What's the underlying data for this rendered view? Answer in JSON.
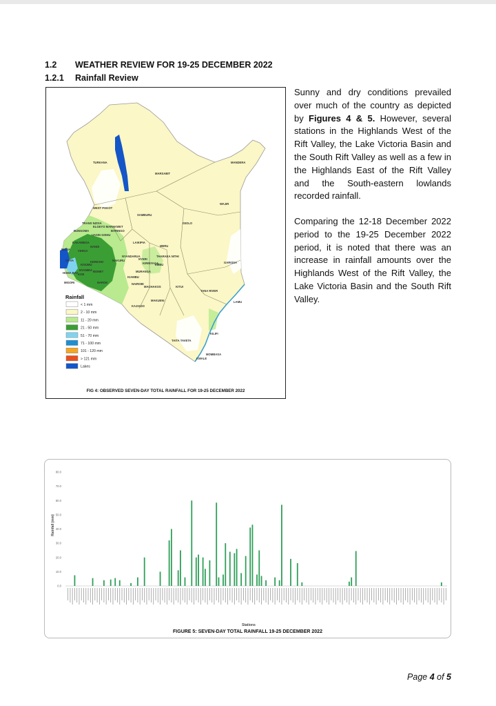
{
  "section": {
    "number": "1.2",
    "title": "WEATHER REVIEW FOR 19-25 DECEMBER 2022",
    "sub_number": "1.2.1",
    "sub_title": "Rainfall Review"
  },
  "map": {
    "caption": "FIG 4: OBSERVED SEVEN-DAY TOTAL RAINFALL FOR 19-25 DECEMBER 2022",
    "legend_title": "Rainfall",
    "legend": [
      {
        "label": "< 1 mm",
        "color": "#ffffff"
      },
      {
        "label": "2 - 10 mm",
        "color": "#fbf7c6"
      },
      {
        "label": "11 - 20 mm",
        "color": "#b9ea8f"
      },
      {
        "label": "21 - 50 mm",
        "color": "#3a9e34"
      },
      {
        "label": "51 - 70 mm",
        "color": "#7fd3ee"
      },
      {
        "label": "71 - 100 mm",
        "color": "#1e8fd2"
      },
      {
        "label": "101 - 120 mm",
        "color": "#f5a623"
      },
      {
        "label": "> 121 mm",
        "color": "#e8501e"
      },
      {
        "label": "Lakes",
        "color": "#1455c8"
      }
    ],
    "county_labels": [
      "TURKANA",
      "MANDERA",
      "MARSABIT",
      "WAJIR",
      "WEST POKOT",
      "SAMBURU",
      "ISIOLO",
      "TRANS NZOIA",
      "ELGEYO MARAKWET",
      "BARINGO",
      "UASIN GISHU",
      "BUNGOMA",
      "KAKAMEGA",
      "NANDI",
      "LAIKIPIA",
      "MERU",
      "BUSIA",
      "VIHIGA",
      "KISUMU",
      "SIAYA",
      "KERICHO",
      "NAKURU",
      "NYANDARUA",
      "NYERI",
      "THARAKA NITHI",
      "EMBU",
      "KIRINYAGA",
      "MURANGA",
      "BOMET",
      "NYAMIRA",
      "KISII",
      "HOMA BAY",
      "MIGORI",
      "NAROK",
      "KIAMBU",
      "NAIROBI",
      "MACHAKOS",
      "KITUI",
      "GARISSA",
      "TANA RIVER",
      "KAJIADO",
      "MAKUENI",
      "LAMU",
      "KILIFI",
      "TAITA TAVETA",
      "KWALE",
      "MOMBASA"
    ]
  },
  "text": {
    "p1_before": "Sunny and dry conditions prevailed over much of the country as depicted by ",
    "p1_bold": "Figures 4 & 5.",
    "p1_after": " However, several stations in the Highlands West of the Rift Valley, the Lake Victoria Basin and the South Rift Valley as well as a few in the Highlands East of the Rift Valley and the South-eastern lowlands recorded rainfall.",
    "p2": "Comparing the 12-18 December 2022 period to the 19-25 December 2022 period, it is noted that there was an increase in rainfall amounts over the Highlands West of the Rift Valley, the Lake Victoria Basin and the South Rift Valley."
  },
  "chart": {
    "caption": "FIGURE 5: SEVEN-DAY TOTAL RAINFALL 19-25 DECEMBER 2022",
    "bar_color": "#2e9e58"
  },
  "chart_data": {
    "type": "bar",
    "title": "",
    "xlabel": "Stations",
    "ylabel": "Rainfall (mm)",
    "ylim": [
      0,
      80
    ],
    "yticks": [
      0,
      10,
      20,
      30,
      40,
      50,
      60,
      70,
      80
    ],
    "grid": false,
    "values": [
      0,
      0,
      0,
      7.5,
      0,
      0,
      0,
      0,
      0,
      0,
      0,
      5.5,
      0,
      0,
      0,
      0,
      4,
      0,
      0,
      4.5,
      0,
      5.5,
      0,
      4,
      0,
      0,
      0,
      0,
      2,
      0,
      0,
      6,
      0,
      0,
      20,
      0,
      0,
      0,
      0,
      0,
      0,
      10,
      0,
      0,
      0,
      32,
      40,
      0,
      0,
      11,
      25,
      0,
      6,
      0,
      0,
      60,
      0,
      20,
      22,
      0,
      20,
      12,
      0,
      18,
      0,
      0,
      58.5,
      6,
      0,
      8,
      30,
      0,
      24,
      0,
      23,
      26,
      0,
      9,
      0,
      21,
      0,
      41,
      43,
      0,
      8,
      25,
      7,
      0,
      4,
      0,
      0,
      0,
      6,
      0,
      4,
      57,
      0,
      0,
      0,
      19,
      0,
      0,
      16,
      0,
      2.5,
      0,
      0,
      0,
      0,
      0,
      0,
      0,
      0,
      0,
      0,
      0,
      0,
      0,
      0,
      0,
      0,
      0,
      0,
      0,
      0,
      3,
      6,
      0,
      24.5,
      0,
      0,
      0,
      0,
      0,
      0,
      0,
      0,
      0,
      0,
      0,
      0,
      0,
      0,
      0,
      0,
      0,
      0,
      0,
      0,
      0,
      0,
      0,
      0,
      0,
      0,
      0,
      0,
      0,
      0,
      0,
      0,
      0,
      0,
      0,
      0,
      0,
      2.5,
      0,
      0
    ]
  },
  "footer": {
    "page_prefix": "Page ",
    "page_num": "4",
    "page_mid": " of ",
    "page_total": "5"
  }
}
